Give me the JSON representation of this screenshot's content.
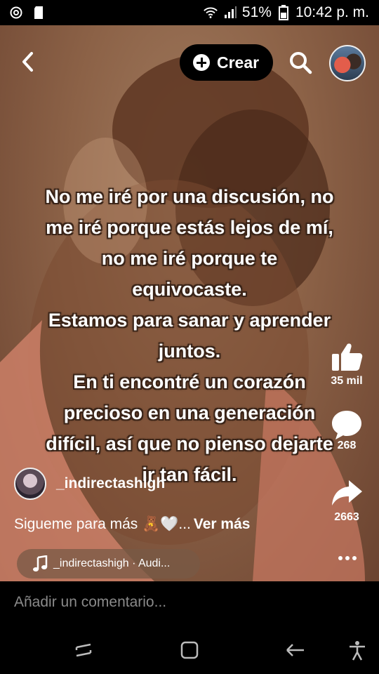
{
  "status_bar": {
    "battery": "51%",
    "time": "10:42 p. m."
  },
  "header": {
    "create_label": "Crear"
  },
  "video": {
    "overlay_text": "No me iré por una discusión, no\nme iré porque estás lejos de mí,\nno me iré porque te\nequivocaste.\nEstamos para sanar y aprender\njuntos.\nEn ti encontré un corazón\nprecioso en una generación\ndifícil, así que no pienso dejarte\nir tan fácil."
  },
  "actions": {
    "likes": "35 mil",
    "comments": "268",
    "shares": "2663"
  },
  "post": {
    "username": "_indirectashigh",
    "caption": "Sigueme para más 🧸🤍...",
    "see_more": "Ver más",
    "audio": "_indirectashigh · Audi..."
  },
  "comment": {
    "placeholder": "Añadir un comentario..."
  },
  "colors": {
    "background": "#000000",
    "video_tone": "#8c6247",
    "accent_text": "#ffffff"
  }
}
